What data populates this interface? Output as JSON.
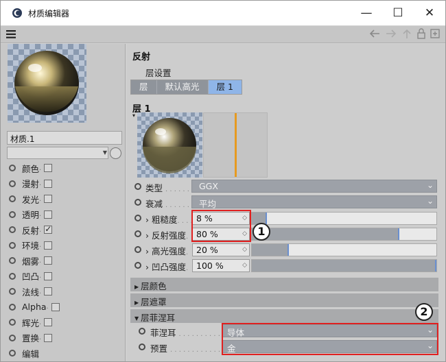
{
  "window": {
    "title": "材质编辑器",
    "controls": {
      "minimize": "—",
      "maximize": "☐",
      "close": "✕"
    }
  },
  "menubar": {
    "icon": "hamburger-menu-icon"
  },
  "nav_icons": [
    "back-arrow-icon",
    "forward-arrow-icon",
    "up-arrow-icon",
    "lock-icon",
    "new-window-icon"
  ],
  "material": {
    "name": "材质.1",
    "field_value": ""
  },
  "channels": [
    {
      "label": "颜色",
      "checked": false
    },
    {
      "label": "漫射",
      "checked": false
    },
    {
      "label": "发光",
      "checked": false
    },
    {
      "label": "透明",
      "checked": false
    },
    {
      "label": "反射",
      "checked": true
    },
    {
      "label": "环境",
      "checked": false
    },
    {
      "label": "烟雾",
      "checked": false
    },
    {
      "label": "凹凸",
      "checked": false
    },
    {
      "label": "法线",
      "checked": false
    },
    {
      "label": "Alpha",
      "checked": false
    },
    {
      "label": "辉光",
      "checked": false
    },
    {
      "label": "置换",
      "checked": false
    },
    {
      "label": "编辑",
      "checked": false
    }
  ],
  "reflection": {
    "section_title": "反射",
    "layer_settings": "层设置",
    "tabs": [
      {
        "label": "层",
        "active": false
      },
      {
        "label": "默认高光",
        "active": false
      },
      {
        "label": "层 1",
        "active": true
      }
    ],
    "layer_title": "层 1",
    "type": {
      "label": "类型",
      "dots": ". . . . . . . .",
      "value": "GGX"
    },
    "falloff": {
      "label": "衰减",
      "dots": ". . . . . . . .",
      "value": "平均"
    },
    "sliders": [
      {
        "label": "› 粗糙度",
        "dots": ". . . .",
        "value": "8 %",
        "fraction": 0.08
      },
      {
        "label": "› 反射强度",
        "dots": ".",
        "value": "80 %",
        "fraction": 0.8
      },
      {
        "label": "› 高光强度",
        "dots": ".",
        "value": "20 %",
        "fraction": 0.2
      },
      {
        "label": "› 凹凸强度",
        "dots": ".",
        "value": "100 %",
        "fraction": 1.0
      }
    ],
    "groups": [
      {
        "label": "层颜色",
        "open": false
      },
      {
        "label": "层遮罩",
        "open": false
      },
      {
        "label": "层菲涅耳",
        "open": true
      }
    ],
    "fresnel": {
      "label": "菲涅耳",
      "dots": ". . . . . . . . . . . . . . .",
      "value": "导体"
    },
    "preset": {
      "label": "预置",
      "dots": ". . . . . . . . . . . . . . . . .",
      "value": "金"
    }
  },
  "callouts": [
    "1",
    "2"
  ],
  "colors": {
    "accent": "#8fb5e8",
    "highlight_box": "#e02020",
    "graph_line": "#e69a20"
  }
}
